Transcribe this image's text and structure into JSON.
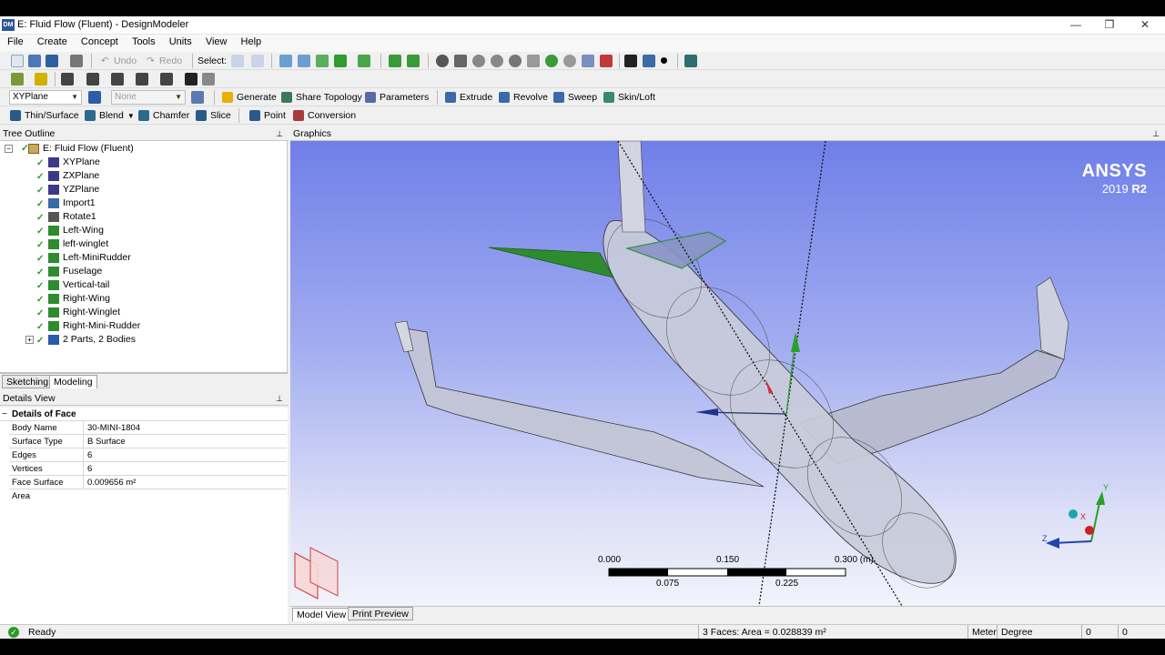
{
  "window": {
    "app_icon_text": "DM",
    "title": "E: Fluid Flow (Fluent) - DesignModeler",
    "minimize_glyph": "—",
    "restore_glyph": "❐",
    "close_glyph": "✕"
  },
  "menu": [
    "File",
    "Create",
    "Concept",
    "Tools",
    "Units",
    "View",
    "Help"
  ],
  "toolbar1": {
    "undo": "Undo",
    "redo": "Redo",
    "select": "Select:"
  },
  "toolbar3": {
    "plane": "XYPlane",
    "sketch": "None",
    "generate": "Generate",
    "share_topology": "Share Topology",
    "parameters": "Parameters",
    "extrude": "Extrude",
    "revolve": "Revolve",
    "sweep": "Sweep",
    "skin_loft": "Skin/Loft"
  },
  "toolbar4": {
    "thin_surface": "Thin/Surface",
    "blend": "Blend",
    "chamfer": "Chamfer",
    "slice": "Slice",
    "point": "Point",
    "conversion": "Conversion"
  },
  "tree": {
    "header": "Tree Outline",
    "root": "E: Fluid Flow (Fluent)",
    "items": [
      {
        "label": "XYPlane",
        "icon": "plane-icon"
      },
      {
        "label": "ZXPlane",
        "icon": "plane-icon"
      },
      {
        "label": "YZPlane",
        "icon": "plane-icon"
      },
      {
        "label": "Import1",
        "icon": "import-icon"
      },
      {
        "label": "Rotate1",
        "icon": "rotate-icon"
      },
      {
        "label": "Left-Wing",
        "icon": "body-icon"
      },
      {
        "label": "left-winglet",
        "icon": "body-icon"
      },
      {
        "label": "Left-MiniRudder",
        "icon": "body-icon"
      },
      {
        "label": "Fuselage",
        "icon": "body-icon"
      },
      {
        "label": "Vertical-tail",
        "icon": "body-icon"
      },
      {
        "label": "Right-Wing",
        "icon": "body-icon"
      },
      {
        "label": "Right-Winglet",
        "icon": "body-icon"
      },
      {
        "label": "Right-Mini-Rudder",
        "icon": "body-icon"
      },
      {
        "label": "2 Parts, 2 Bodies",
        "icon": "parts-icon"
      }
    ]
  },
  "mode_tabs": [
    "Sketching",
    "Modeling"
  ],
  "details": {
    "header": "Details View",
    "section": "Details of Face",
    "rows": [
      {
        "key": "Body Name",
        "value": "30-MINI-1804"
      },
      {
        "key": "Surface Type",
        "value": "B Surface"
      },
      {
        "key": "Edges",
        "value": "6"
      },
      {
        "key": "Vertices",
        "value": "6"
      },
      {
        "key": "Face Surface Area",
        "value": "0.009656 m²"
      }
    ]
  },
  "graphics": {
    "header": "Graphics",
    "brand": "ANSYS",
    "version": "2019",
    "release": "R2",
    "scale_top": [
      "0.000",
      "0.150",
      "0.300 (m)"
    ],
    "scale_bottom": [
      "0.075",
      "0.225"
    ],
    "axis_x": "X",
    "axis_y": "Y",
    "axis_z": "Z"
  },
  "view_tabs": [
    "Model View",
    "Print Preview"
  ],
  "status": {
    "ready": "Ready",
    "selection": "3 Faces: Area = 0.028839 m²",
    "length_unit": "Meter",
    "angle_unit": "Degree",
    "v1": "0",
    "v2": "0"
  },
  "colors": {
    "selection_green": "#2e8b2e",
    "viewport_top": "#6f7fe8",
    "viewport_bottom": "#f2f3fb"
  }
}
